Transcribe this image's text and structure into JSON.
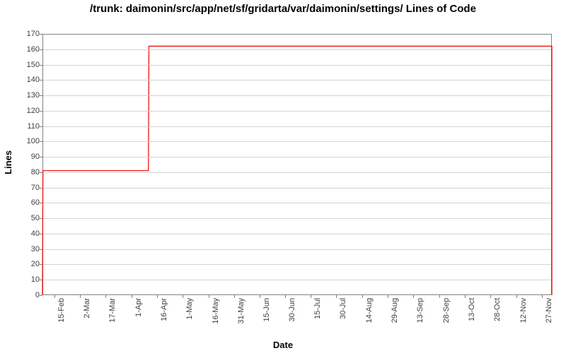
{
  "chart_data": {
    "type": "line",
    "title": "/trunk: daimonin/src/app/net/sf/gridarta/var/daimonin/settings/ Lines of Code",
    "xlabel": "Date",
    "ylabel": "Lines",
    "ylim": [
      0,
      170
    ],
    "y_ticks": [
      0,
      10,
      20,
      30,
      40,
      50,
      60,
      70,
      80,
      90,
      100,
      110,
      120,
      130,
      140,
      150,
      160,
      170
    ],
    "x_ticks": [
      "15-Feb",
      "2-Mar",
      "17-Mar",
      "1-Apr",
      "16-Apr",
      "1-May",
      "16-May",
      "31-May",
      "15-Jun",
      "30-Jun",
      "15-Jul",
      "30-Jul",
      "14-Aug",
      "29-Aug",
      "13-Sep",
      "28-Sep",
      "13-Oct",
      "28-Oct",
      "12-Nov",
      "27-Nov"
    ],
    "series": [
      {
        "name": "Lines of Code",
        "color": "#ee0000",
        "points": [
          {
            "date": "8-Feb",
            "x_rel": 0.0,
            "y": 0
          },
          {
            "date": "8-Feb",
            "x_rel": 0.001,
            "y": 81
          },
          {
            "date": "11-Apr",
            "x_rel": 0.208,
            "y": 81
          },
          {
            "date": "11-Apr",
            "x_rel": 0.209,
            "y": 162
          },
          {
            "date": "4-Dec",
            "x_rel": 1.0,
            "y": 162
          },
          {
            "date": "4-Dec",
            "x_rel": 1.0,
            "y": 0
          }
        ]
      }
    ],
    "x_tick_rel": [
      0.024,
      0.074,
      0.124,
      0.175,
      0.225,
      0.275,
      0.326,
      0.376,
      0.426,
      0.477,
      0.527,
      0.577,
      0.628,
      0.678,
      0.728,
      0.779,
      0.829,
      0.879,
      0.93,
      0.98
    ]
  }
}
